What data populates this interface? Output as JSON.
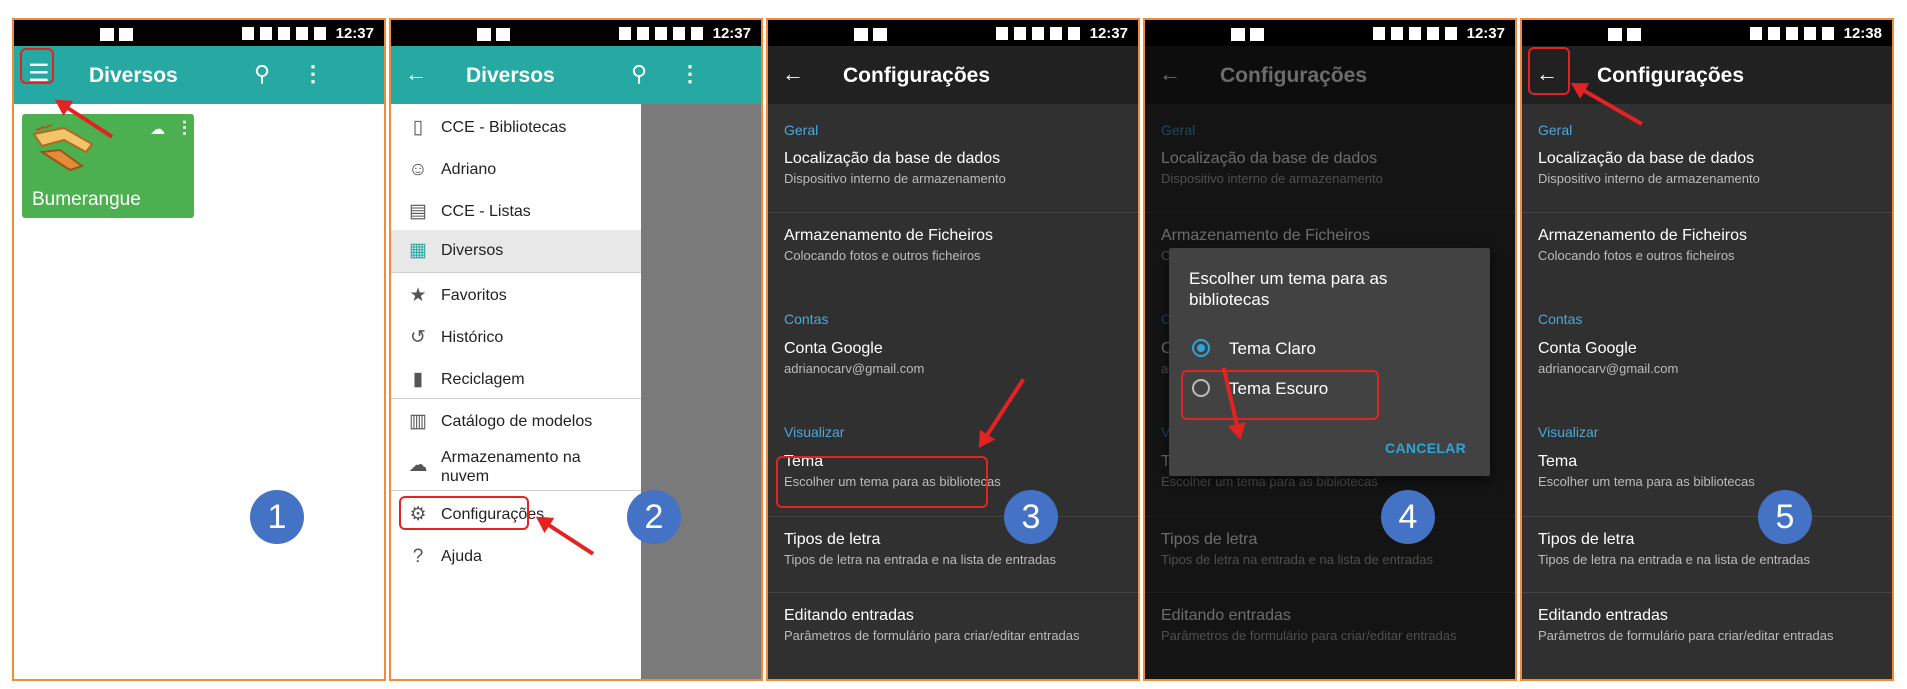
{
  "status_bar": {
    "times": [
      "12:37",
      "12:37",
      "12:37",
      "12:37",
      "12:38"
    ]
  },
  "panel1": {
    "title": "Diversos",
    "card_title": "Bumerangue",
    "step": "1",
    "colors": {
      "toolbar": "#26a9a3",
      "card": "#4caf50"
    }
  },
  "panel2": {
    "title": "Diversos",
    "step": "2",
    "drawer_items": [
      {
        "label": "CCE - Bibliotecas",
        "icon": "book-icon"
      },
      {
        "label": "Adriano",
        "icon": "smiley-icon"
      },
      {
        "label": "CCE - Listas",
        "icon": "clipboard-icon"
      },
      {
        "label": "Diversos",
        "icon": "grid-icon",
        "selected": true
      },
      {
        "label": "Favoritos",
        "icon": "star-icon"
      },
      {
        "label": "Histórico",
        "icon": "history-icon"
      },
      {
        "label": "Reciclagem",
        "icon": "trash-icon"
      },
      {
        "label": "Catálogo de modelos",
        "icon": "catalog-icon"
      },
      {
        "label": "Armazenamento na nuvem",
        "icon": "cloud-icon"
      },
      {
        "label": "Configurações",
        "icon": "gear-icon"
      },
      {
        "label": "Ajuda",
        "icon": "help-icon"
      }
    ]
  },
  "settings": {
    "title": "Configurações",
    "sections": {
      "geral": "Geral",
      "contas": "Contas",
      "visualizar": "Visualizar"
    },
    "prefs": {
      "db_location": {
        "title": "Localização da base de dados",
        "summary": "Dispositivo interno de armazenamento"
      },
      "files": {
        "title": "Armazenamento de Ficheiros",
        "summary": "Colocando fotos e outros ficheiros"
      },
      "google": {
        "title": "Conta Google",
        "summary": "adrianocarv@gmail.com"
      },
      "theme": {
        "title": "Tema",
        "summary": "Escolher um tema para as bibliotecas"
      },
      "fonts": {
        "title": "Tipos de letra",
        "summary": "Tipos de letra na entrada e na lista de entradas"
      },
      "editing": {
        "title": "Editando entradas",
        "summary": "Parâmetros de formulário para criar/editar entradas"
      }
    },
    "colors": {
      "background": "#303030",
      "toolbar": "#212121",
      "accent": "#4aa8d8"
    }
  },
  "panel3": {
    "step": "3"
  },
  "panel4": {
    "step": "4",
    "dialog": {
      "title": "Escolher um tema para as bibliotecas",
      "options": [
        "Tema Claro",
        "Tema Escuro"
      ],
      "selected": "Tema Claro",
      "cancel": "CANCELAR"
    }
  },
  "panel5": {
    "step": "5"
  },
  "annotation_colors": {
    "highlight": "#e52222",
    "step_badge": "#4472c4",
    "panel_border": "#f08a3c"
  }
}
